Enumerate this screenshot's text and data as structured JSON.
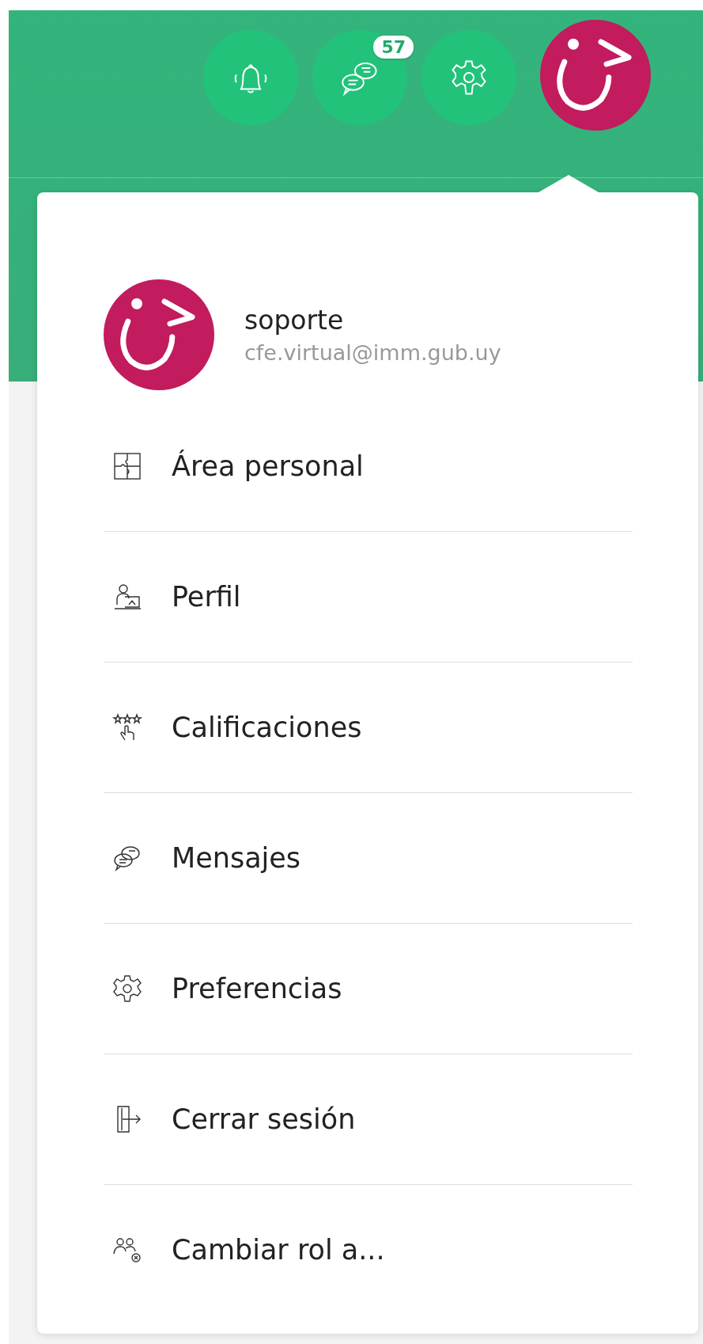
{
  "header": {
    "buttons": [
      {
        "kind": "bell"
      },
      {
        "kind": "chat",
        "badge": "57"
      },
      {
        "kind": "gear"
      }
    ]
  },
  "user_menu": {
    "name": "soporte",
    "email": "cfe.virtual@imm.gub.uy",
    "items": [
      {
        "kind": "puzzle",
        "label": "Área personal"
      },
      {
        "kind": "profile",
        "label": "Perfil"
      },
      {
        "kind": "grades",
        "label": "Calificaciones"
      },
      {
        "kind": "chat",
        "label": "Mensajes"
      },
      {
        "kind": "gear",
        "label": "Preferencias"
      },
      {
        "kind": "logout",
        "label": "Cerrar sesión"
      },
      {
        "kind": "users",
        "label": "Cambiar rol a..."
      }
    ]
  }
}
